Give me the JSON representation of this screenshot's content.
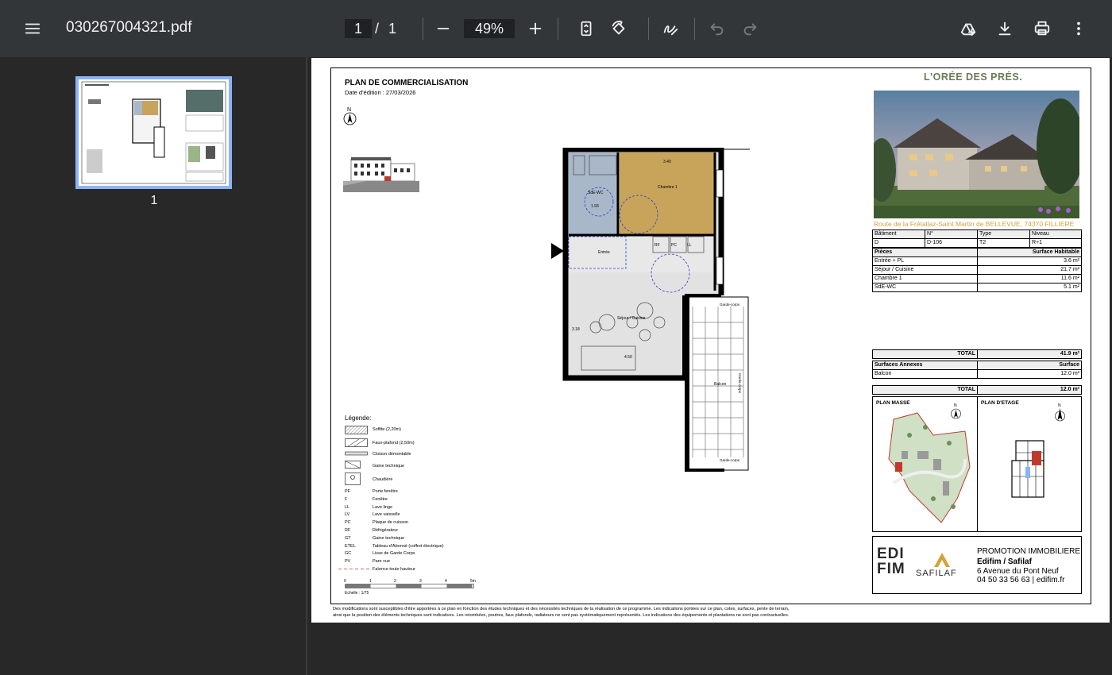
{
  "toolbar": {
    "file_name": "030267004321.pdf",
    "page_current": "1",
    "page_separator": "/",
    "page_total": "1",
    "zoom": "49%"
  },
  "sidebar": {
    "thumbnail_label": "1"
  },
  "document": {
    "heading": "PLAN DE COMMERCIALISATION",
    "edit_date": "Date d'édition :  27/03/2026",
    "north": "N",
    "brand": "L'ORÉE DES PRÉS.",
    "address": "Route de la Frétallaz-Saint Martin de BELLEVUE, 74370 FILLIERE",
    "info_headers": [
      "Bâtiment",
      "N°",
      "Type",
      "Niveau"
    ],
    "info_values": [
      "D",
      "D-106",
      "T2",
      "R+1"
    ],
    "rooms_header": [
      "Pièces",
      "Surface Habitable"
    ],
    "rooms": [
      {
        "name": "Entrée + PL",
        "area": "3.6 m²"
      },
      {
        "name": "Séjour / Cuisine",
        "area": "21.7 m²"
      },
      {
        "name": "Chambre 1",
        "area": "11.6 m²"
      },
      {
        "name": "SdE-WC",
        "area": "5.1 m²"
      }
    ],
    "total_label": "TOTAL",
    "total_area": "41.9 m²",
    "annex_header": [
      "Surfaces Annexes",
      "Surface"
    ],
    "annex": [
      {
        "name": "Balcon",
        "area": "12.0 m²"
      }
    ],
    "annex_total": "12.0 m²",
    "plan_masse": "PLAN MASSE",
    "plan_etage": "PLAN D'ETAGE",
    "promo_title": "PROMOTION IMMOBILIERE",
    "promo_company": "Edifim / Safilaf",
    "promo_address": "6 Avenue du Pont Neuf",
    "promo_contact": "04 50 33 56 63 | edifim.fr",
    "logo_edifim": "EDI FIM",
    "logo_safilaf": "SAFILAF",
    "legend_title": "Légende:",
    "legend_swatches": [
      "Soffite (2,20m)",
      "Faux-plafond (2,50m)",
      "Cloison démontable",
      "Gaine technique",
      "Chaudière"
    ],
    "legend_codes": [
      {
        "code": "PF",
        "label": "Porte fenêtre"
      },
      {
        "code": "F",
        "label": "Fenêtre"
      },
      {
        "code": "LL",
        "label": "Lave linge"
      },
      {
        "code": "LV",
        "label": "Lave vaisselle"
      },
      {
        "code": "PC",
        "label": "Plaque de cuisson"
      },
      {
        "code": "RF",
        "label": "Réfrigérateur"
      },
      {
        "code": "GT",
        "label": "Gaine technique"
      },
      {
        "code": "ETEL",
        "label": "Tableau d'Abonné (coffret électrique)"
      },
      {
        "code": "GC",
        "label": "Lisse de Garde Corps"
      },
      {
        "code": "PV",
        "label": "Pare vue"
      },
      {
        "code": "",
        "label": "Faïence toute hauteur"
      }
    ],
    "scale_ticks": [
      "0",
      "1",
      "2",
      "3",
      "4",
      "5m"
    ],
    "scale_label": "Echelle : 1/75",
    "disclaimer_1": "Des modifications sont susceptibles d'être apportées à ce plan en fonction des études techniques et des nécessités techniques de la réalisation de ce programme.   Les indications portées sur ce plan, cotes, surfaces, pente de terrain,",
    "disclaimer_2": "ainsi que la position des éléments techniques sont indicatives.  Les retombées, poutres, faux plafonds, radiateurs ne sont pas systématiquement représentés. Les indications des équipements et plantations ne sont pas contractuelles.",
    "plan_labels": {
      "chambre": "Chambre 1",
      "sde": "SdE-WC",
      "entree": "Entrée",
      "sejour": "Séjour / Cuisine",
      "balcon": "Balcon",
      "dim_340": "3.40",
      "dim_450": "4.50",
      "dim_193": "1.93",
      "dim_318": "3.18",
      "rf": "RF",
      "pc": "PC",
      "ll": "LL",
      "gc1": "Garde-corps",
      "gc2": "Garde-corps",
      "gc3": "Garde-corps"
    }
  },
  "colors": {
    "toolbar_bg": "#323639",
    "viewer_bg": "#282828",
    "thumb_highlight": "#8ab4f8",
    "chambre_fill": "#c8a45a",
    "sde_fill": "#a9b8c9",
    "floor_fill": "#e2e2e2",
    "brand_green": "#6b7b54",
    "brand_gold": "#d4a23a"
  }
}
